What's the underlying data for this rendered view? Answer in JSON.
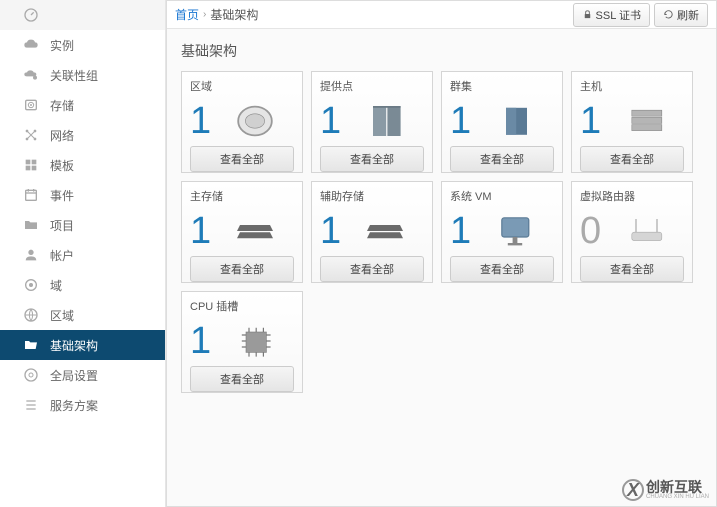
{
  "breadcrumb": {
    "home": "首页",
    "current": "基础架构"
  },
  "buttons": {
    "ssl": "SSL 证书",
    "refresh": "刷新"
  },
  "sidebar": {
    "items": [
      {
        "label": ""
      },
      {
        "label": "实例"
      },
      {
        "label": "关联性组"
      },
      {
        "label": "存储"
      },
      {
        "label": "网络"
      },
      {
        "label": "模板"
      },
      {
        "label": "事件"
      },
      {
        "label": "项目"
      },
      {
        "label": "帐户"
      },
      {
        "label": "域"
      },
      {
        "label": "区域"
      },
      {
        "label": "基础架构"
      },
      {
        "label": "全局设置"
      },
      {
        "label": "服务方案"
      }
    ]
  },
  "page": {
    "title": "基础架构"
  },
  "cards": [
    {
      "title": "区域",
      "count": "1",
      "btn": "查看全部"
    },
    {
      "title": "提供点",
      "count": "1",
      "btn": "查看全部"
    },
    {
      "title": "群集",
      "count": "1",
      "btn": "查看全部"
    },
    {
      "title": "主机",
      "count": "1",
      "btn": "查看全部"
    },
    {
      "title": "主存储",
      "count": "1",
      "btn": "查看全部"
    },
    {
      "title": "辅助存储",
      "count": "1",
      "btn": "查看全部"
    },
    {
      "title": "系统 VM",
      "count": "1",
      "btn": "查看全部"
    },
    {
      "title": "虚拟路由器",
      "count": "0",
      "btn": "查看全部"
    },
    {
      "title": "CPU 插槽",
      "count": "1",
      "btn": "查看全部"
    }
  ],
  "watermark": {
    "text1": "创新",
    "text2": "互联",
    "sub": "CHUANG XIN HU LIAN"
  }
}
